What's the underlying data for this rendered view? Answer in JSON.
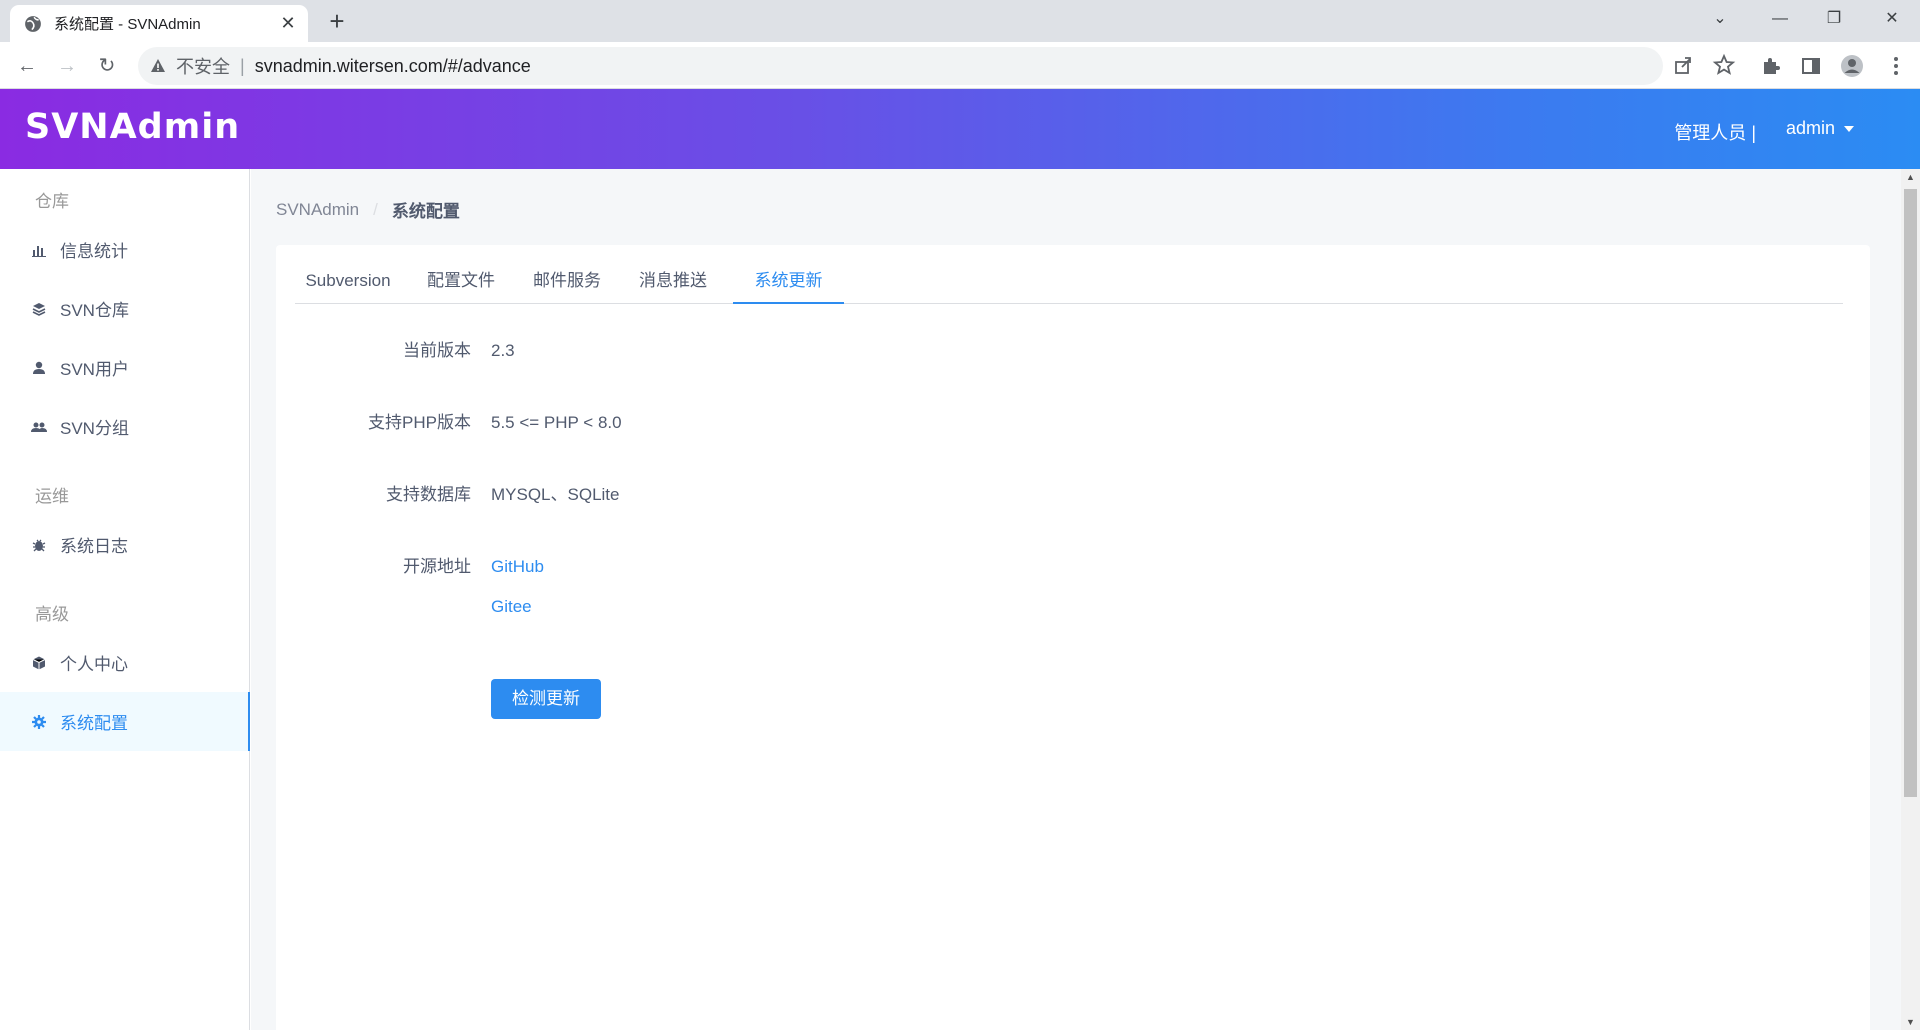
{
  "browser": {
    "tab_title": "系统配置 - SVNAdmin",
    "insecure_label": "不安全",
    "url_separator": "|",
    "url": "svnadmin.witersen.com/#/advance"
  },
  "header": {
    "logo": "SVNAdmin",
    "role": "管理人员 |",
    "username": "admin"
  },
  "sidebar": {
    "groups": [
      {
        "title": "仓库"
      },
      {
        "title": "运维"
      },
      {
        "title": "高级"
      }
    ],
    "items": [
      {
        "label": "信息统计",
        "icon": "bar-chart-icon"
      },
      {
        "label": "SVN仓库",
        "icon": "layers-icon"
      },
      {
        "label": "SVN用户",
        "icon": "user-icon"
      },
      {
        "label": "SVN分组",
        "icon": "users-icon"
      },
      {
        "label": "系统日志",
        "icon": "bug-icon"
      },
      {
        "label": "个人中心",
        "icon": "cube-icon"
      },
      {
        "label": "系统配置",
        "icon": "gear-icon",
        "active": true
      }
    ]
  },
  "breadcrumb": {
    "root": "SVNAdmin",
    "separator": "/",
    "current": "系统配置"
  },
  "tabs": [
    {
      "label": "Subversion"
    },
    {
      "label": "配置文件"
    },
    {
      "label": "邮件服务"
    },
    {
      "label": "消息推送"
    },
    {
      "label": "系统更新",
      "active": true
    }
  ],
  "update": {
    "current_version_label": "当前版本",
    "current_version": "2.3",
    "php_label": "支持PHP版本",
    "php_value": "5.5 <= PHP < 8.0",
    "db_label": "支持数据库",
    "db_value": "MYSQL、SQLite",
    "source_label": "开源地址",
    "link_github": "GitHub",
    "link_gitee": "Gitee",
    "check_button": "检测更新"
  },
  "colors": {
    "primary": "#2d8cf0",
    "header_gradient_start": "#8a2be2",
    "header_gradient_end": "#2b8cf3"
  }
}
